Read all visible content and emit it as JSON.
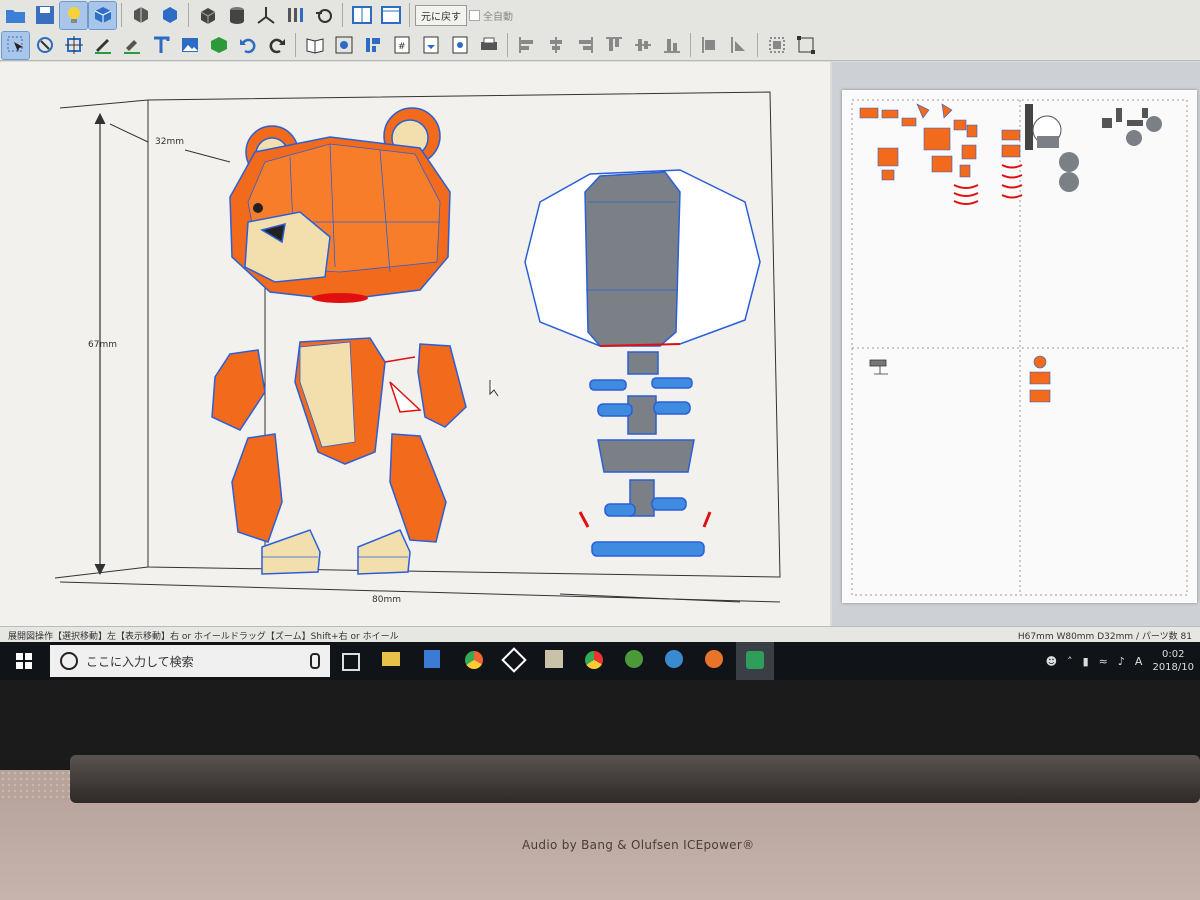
{
  "toolbar": {
    "undo_label": "元に戻す",
    "auto_label": "全自動",
    "row1_icons": [
      "open-folder-icon",
      "save-icon",
      "bulb-icon",
      "cube-view-icon",
      "unfold-icon",
      "shade-icon",
      "box-icon",
      "cylinder-icon",
      "axis-icon",
      "bars-icon",
      "edge-icon",
      "single-view-icon",
      "dual-view-icon"
    ],
    "row2_icons": [
      "select-icon",
      "rotate-icon",
      "move-icon",
      "pen-icon",
      "paint-icon",
      "text-icon",
      "image-icon",
      "part-icon",
      "undo-icon",
      "redo-icon",
      "book-icon",
      "zoom-fit-icon",
      "layout-icon",
      "page-number-icon",
      "export-icon",
      "pdf-icon",
      "print-icon",
      "align-left-icon",
      "align-center-icon",
      "align-right-icon",
      "align-top-icon",
      "align-middle-icon",
      "align-bottom-icon",
      "distribute-h-icon",
      "distribute-v-icon",
      "group-icon",
      "ungroup-icon"
    ]
  },
  "viewport": {
    "dim_depth": "32mm",
    "dim_height": "67mm",
    "dim_width": "80mm"
  },
  "statusbar": {
    "left": "展開図操作【選択移動】左【表示移動】右 or ホイールドラッグ【ズーム】Shift+右 or ホイール",
    "right": "H67mm W80mm D32mm / パーツ数 81"
  },
  "taskbar": {
    "search_placeholder": "ここに入力して検索",
    "time": "0:02",
    "date": "2018/10",
    "ime": "A"
  },
  "laptop": {
    "audio_branding": "Audio by Bang & Olufsen ICEpower®"
  },
  "colors": {
    "bear_orange": "#f26a1b",
    "bear_tan": "#f3dfae",
    "edge_blue": "#2a5fd8",
    "gray_part": "#7b8086",
    "cut_red": "#e01010"
  }
}
